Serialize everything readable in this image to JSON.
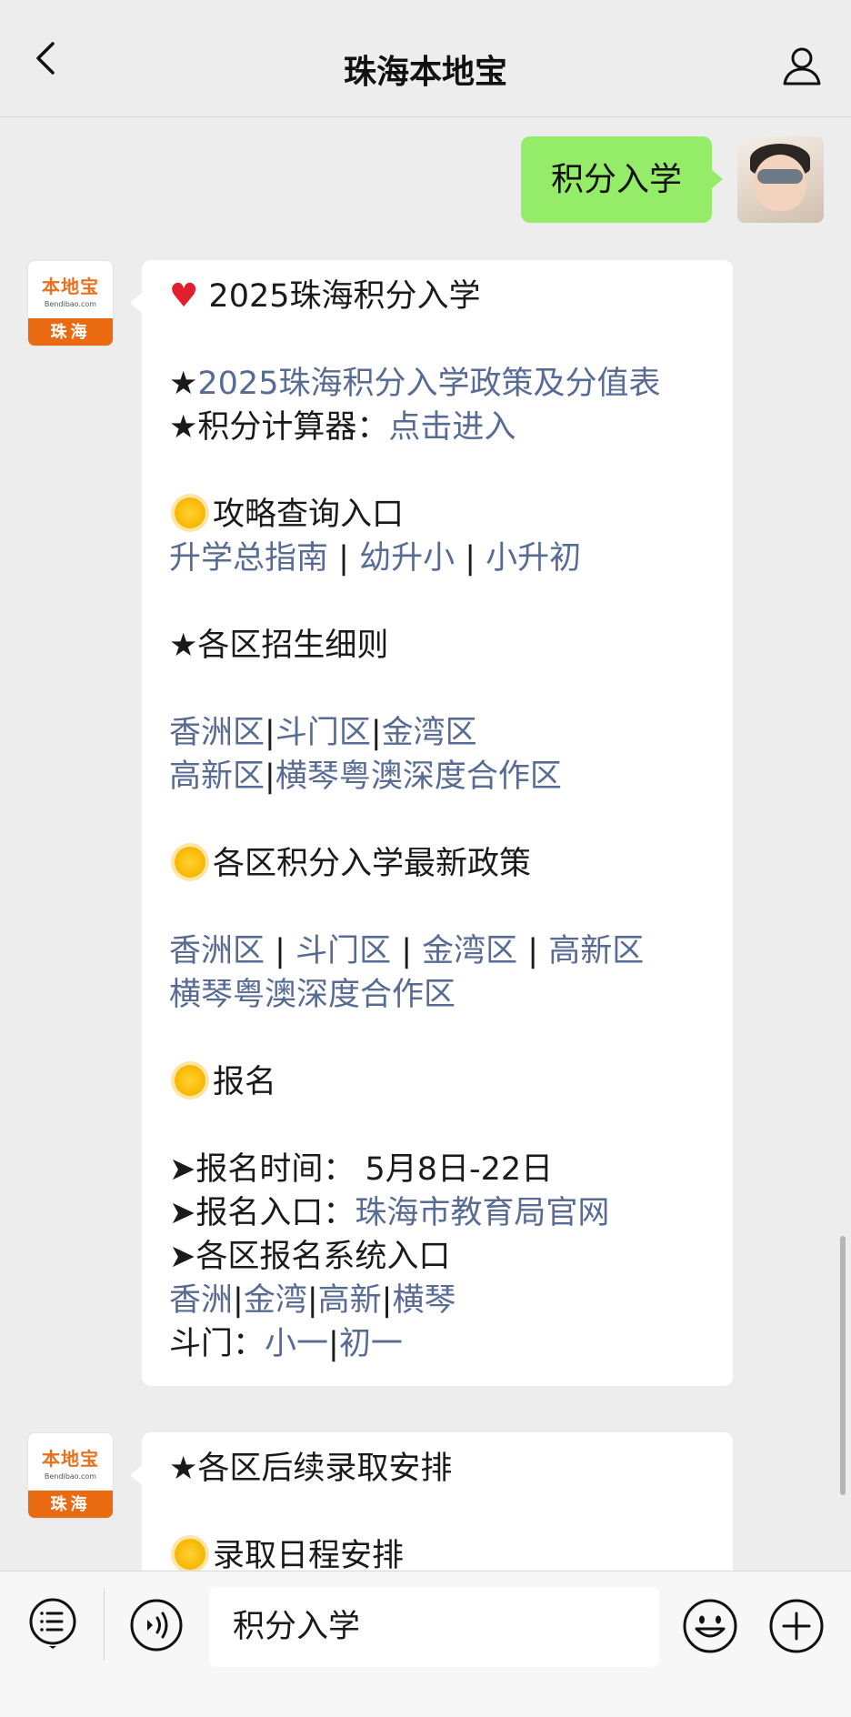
{
  "header": {
    "title": "珠海本地宝"
  },
  "user_message": {
    "text": "积分入学"
  },
  "account": {
    "logo_brand": "本地宝",
    "logo_domain": "Bendibao.com",
    "logo_city": "珠海"
  },
  "message1": {
    "l1": "2025珠海积分入学",
    "l2_star": "★",
    "l2_link": "2025珠海积分入学政策及分值表",
    "l3_text": "★积分计算器：",
    "l3_link": "点击进入",
    "l4": "攻略查询入口",
    "l5_a": "升学总指南",
    "l5_sep1": " | ",
    "l5_b": "幼升小",
    "l5_sep2": " | ",
    "l5_c": "小升初",
    "l6": "★各区招生细则",
    "l7_a": "香洲区",
    "l7_sep1": "|",
    "l7_b": "斗门区",
    "l7_sep2": "|",
    "l7_c": "金湾区",
    "l8_a": "高新区",
    "l8_sep": "|",
    "l8_b": "横琴粤澳深度合作区",
    "l9": "各区积分入学最新政策",
    "l10_a": "香洲区",
    "l10_sep1": " | ",
    "l10_b": "斗门区",
    "l10_sep2": " | ",
    "l10_c": "金湾区",
    "l10_sep3": " | ",
    "l10_d": "高新区",
    "l11": "横琴粤澳深度合作区",
    "l12": "报名",
    "l13": "➤报名时间： 5月8日-22日",
    "l14_text": "➤报名入口：",
    "l14_link": "珠海市教育局官网",
    "l15": "➤各区报名系统入口",
    "l16_a": "香洲",
    "l16_sep1": "|",
    "l16_b": "金湾",
    "l16_sep2": "|",
    "l16_c": "高新",
    "l16_sep3": "|",
    "l16_d": "横琴",
    "l17_text": "斗门：",
    "l17_a": "小一",
    "l17_sep": "|",
    "l17_b": "初一"
  },
  "message2": {
    "l1": "★各区后续录取安排",
    "l2": "录取日程安排"
  },
  "input": {
    "value": "积分入学"
  },
  "colors": {
    "link": "#576b95",
    "user_bubble": "#95ec69",
    "brand_orange": "#ea6a12"
  }
}
